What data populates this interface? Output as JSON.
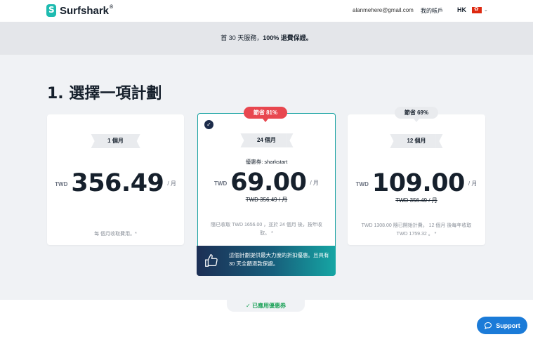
{
  "header": {
    "brand": "Surfshark",
    "brand_mark": "®",
    "email": "alanmehere@gmail.com",
    "account": "我的帳戶",
    "region": "HK",
    "flag_icon": "hong-kong-flag-icon"
  },
  "banner": {
    "prefix": "首 30 天服務，",
    "bold": "100% 退費保證。"
  },
  "title": "1. 選擇一項計劃",
  "plans": [
    {
      "ribbon": "1 個月",
      "currency": "TWD",
      "amount": "356.49",
      "per": "/ 月",
      "note": "每 個月收取費用。*"
    },
    {
      "ribbon": "24 個月",
      "badge": "節省 81%",
      "coupon": "優惠券: sharkstart",
      "currency": "TWD",
      "amount": "69.00",
      "per": "/ 月",
      "strike": "TWD 356.49 / 月",
      "note": "隨已收取 TWD 1656.00 ，並於 24 個月 後，按年收取。 *",
      "selected": true
    },
    {
      "ribbon": "12 個月",
      "badge": "節省 69%",
      "currency": "TWD",
      "amount": "109.00",
      "per": "/ 月",
      "strike": "TWD 356.49 / 月",
      "note": "TWD 1308.00 隨已開始計費。 12 個月 後每年收取 TWD 1759.32 。 *"
    }
  ],
  "promo": {
    "text": "這個計劃提供最大力度的折扣優惠。且具有 30 天全額退款保證。",
    "icon": "thumbs-up-icon"
  },
  "applied": "✓ 已應用優惠券",
  "support": "Support",
  "colors": {
    "accent_teal": "#1ebbb0",
    "badge_red": "#e8474f",
    "support_blue": "#1b7bd8",
    "applied_green": "#1ea35a"
  }
}
